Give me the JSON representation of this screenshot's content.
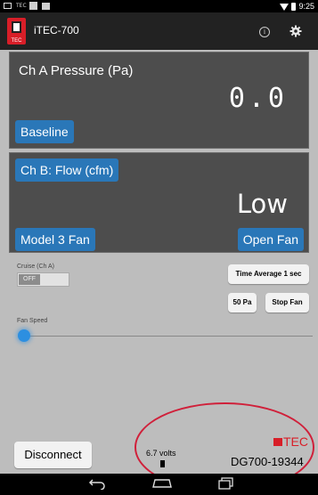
{
  "status_bar": {
    "time": "9:25",
    "left_icons": [
      "screenshot-icon",
      "tec-notification-icon",
      "image-icon",
      "download-icon"
    ],
    "right_icons": [
      "wifi-icon",
      "battery-icon"
    ]
  },
  "app_bar": {
    "logo_text": "TEC",
    "title": "iTEC-700",
    "icons": [
      "info-icon",
      "settings-icon"
    ]
  },
  "channel_a": {
    "title": "Ch A Pressure (Pa)",
    "value": "0.0",
    "button_label": "Baseline"
  },
  "channel_b": {
    "title": "Ch B: Flow (cfm)",
    "value": "Low",
    "config_button_label": "Model 3 Fan",
    "open_fan_button_label": "Open Fan"
  },
  "controls": {
    "cruise_label": "Cruise (Ch A)",
    "toggle_state": "OFF",
    "time_average_label": "Time Average 1 sec",
    "pa_button_label": "50 Pa",
    "stop_fan_label": "Stop Fan",
    "fan_speed_label": "Fan Speed",
    "fan_speed_value": 0
  },
  "footer": {
    "disconnect_label": "Disconnect",
    "volts": "6.7 volts",
    "brand": "TEC",
    "serial": "DG700-19344"
  },
  "colors": {
    "accent_blue": "#2a77b8",
    "brand_red": "#d81e28",
    "annotation_red": "#d0203a",
    "panel_bg": "#4d4d4d"
  },
  "nav_bar": {
    "icons": [
      "back-icon",
      "home-icon",
      "recents-icon"
    ]
  }
}
